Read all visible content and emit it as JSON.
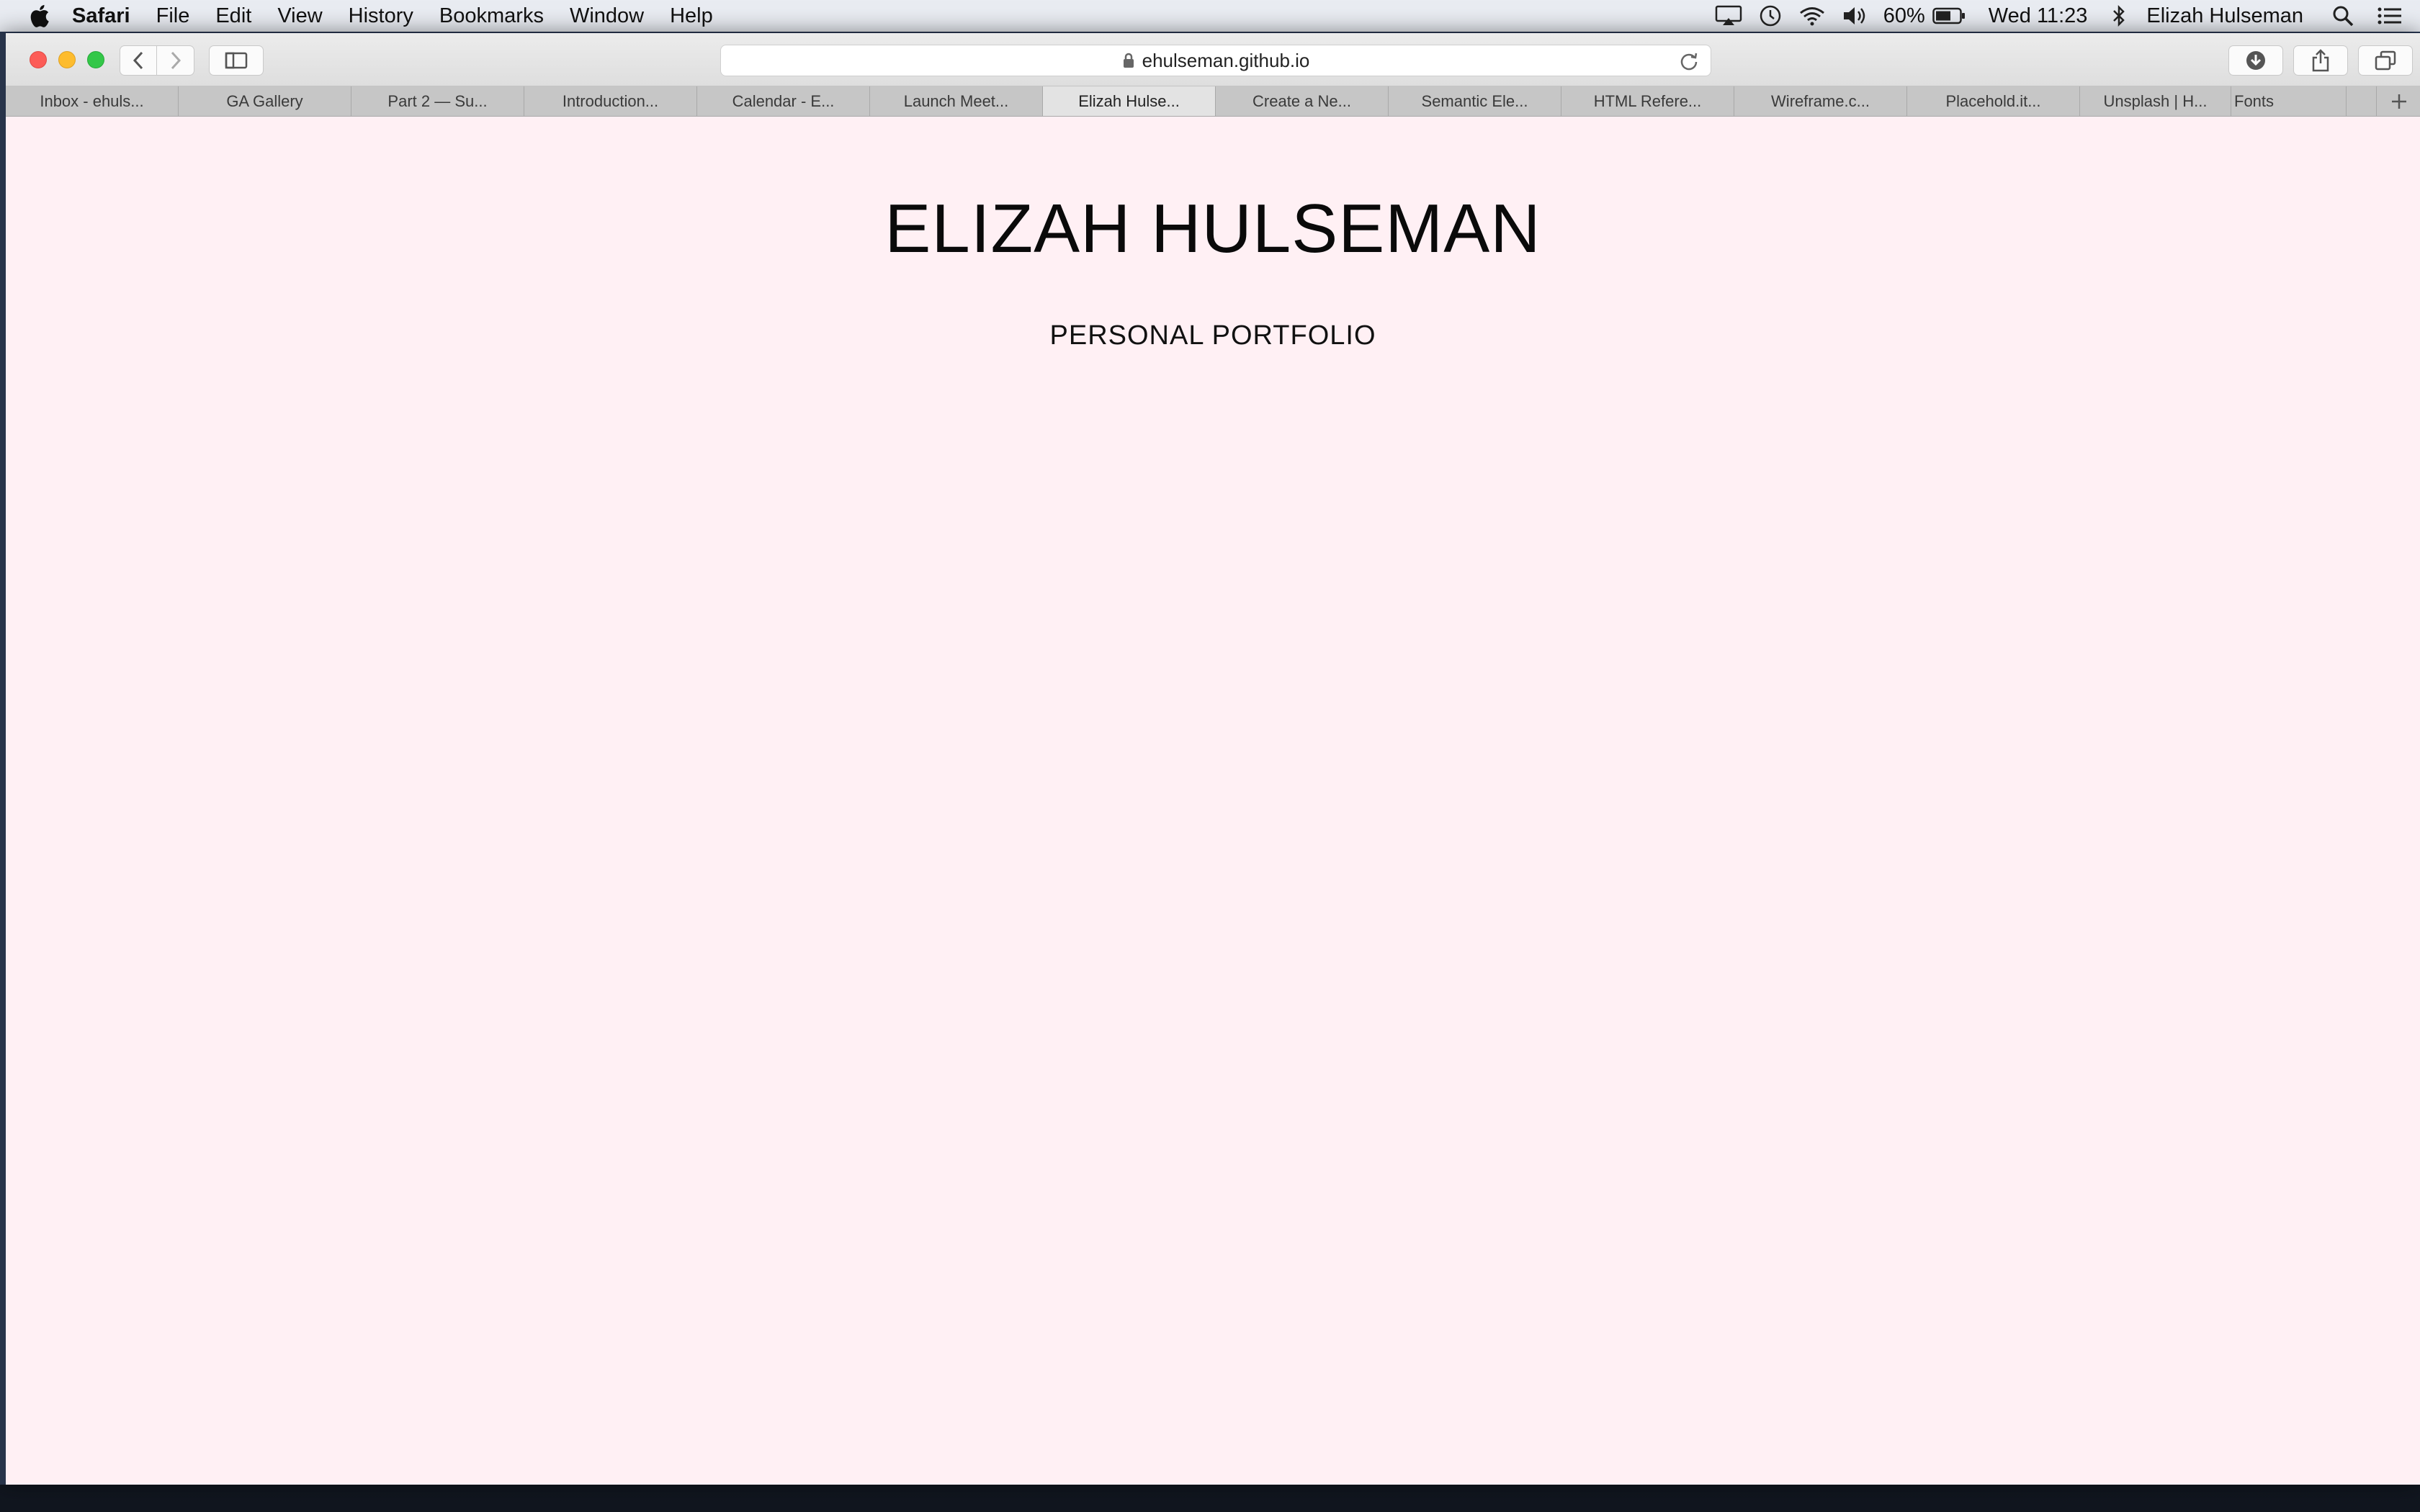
{
  "menubar": {
    "app_name": "Safari",
    "items": [
      "File",
      "Edit",
      "View",
      "History",
      "Bookmarks",
      "Window",
      "Help"
    ],
    "battery_percent": "60%",
    "clock": "Wed 11:23",
    "user": "Elizah Hulseman"
  },
  "toolbar": {
    "url": "ehulseman.github.io"
  },
  "tabs": [
    "Inbox - ehuls...",
    "GA Gallery",
    "Part 2 — Su...",
    "Introduction...",
    "Calendar - E...",
    "Launch Meet...",
    "Elizah Hulse...",
    "Create a Ne...",
    "Semantic Ele...",
    "HTML Refere...",
    "Wireframe.c...",
    "Placehold.it...",
    "Unsplash | H...",
    "Fonts"
  ],
  "active_tab_index": 6,
  "page": {
    "title": "ELIZAH HULSEMAN",
    "subtitle": "PERSONAL PORTFOLIO",
    "background_color": "#fff0f4"
  }
}
